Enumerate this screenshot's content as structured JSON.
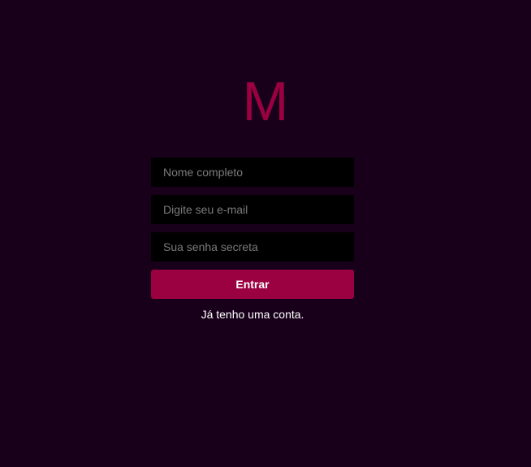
{
  "logo": {
    "letter": "M"
  },
  "form": {
    "name_placeholder": "Nome completo",
    "email_placeholder": "Digite seu e-mail",
    "password_placeholder": "Sua senha secreta",
    "submit_label": "Entrar",
    "login_link": "Já tenho uma conta."
  },
  "colors": {
    "background": "#18001a",
    "accent": "#9b0041",
    "input_background": "#000000",
    "placeholder": "#7b7b7b",
    "text": "#ffffff"
  }
}
